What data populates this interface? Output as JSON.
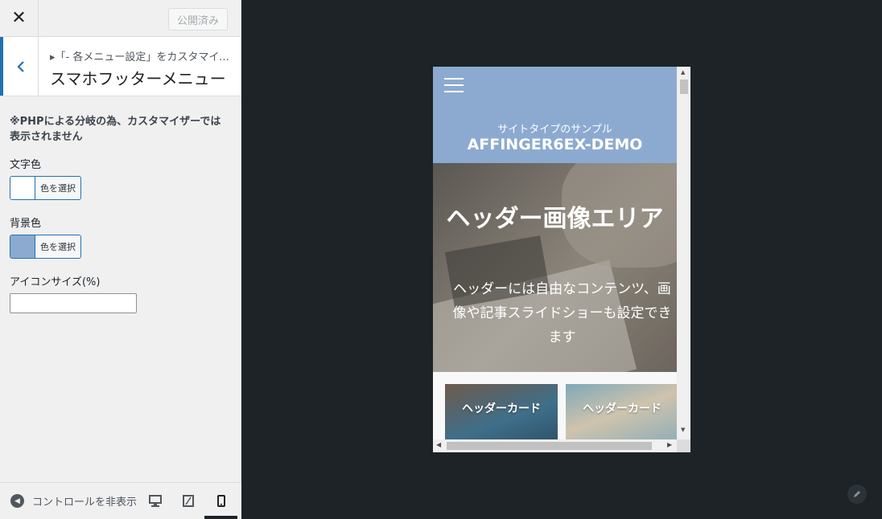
{
  "sidebar": {
    "close_label": "✕",
    "publish_label": "公開済み",
    "breadcrumb": "▸「- 各メニュー設定」をカスタマイズ中",
    "section_title": "スマホフッターメニュー",
    "note": "※PHPによる分岐の為、カスタマイザーでは表示されません",
    "text_color": {
      "label": "文字色",
      "button": "色を選択",
      "value": "#ffffff"
    },
    "bg_color": {
      "label": "背景色",
      "button": "色を選択",
      "value": "#8caad0"
    },
    "icon_size": {
      "label": "アイコンサイズ(%)",
      "value": ""
    },
    "footer": {
      "collapse_label": "コントロールを非表示",
      "devices": [
        "desktop",
        "tablet",
        "mobile"
      ],
      "active_device": "mobile"
    }
  },
  "preview": {
    "tagline": "サイトタイプのサンプル",
    "site_name": "AFFINGER6EX-DEMO",
    "hero_title": "ヘッダー画像エリア",
    "hero_text": "ヘッダーには自由なコンテンツ、画像や記事スライドショーも設定できます",
    "cards": [
      "ヘッダーカード",
      "ヘッダーカード"
    ],
    "header_color": "#8caad0"
  },
  "colors": {
    "accent": "#2271b1",
    "canvas": "#1d2327"
  }
}
